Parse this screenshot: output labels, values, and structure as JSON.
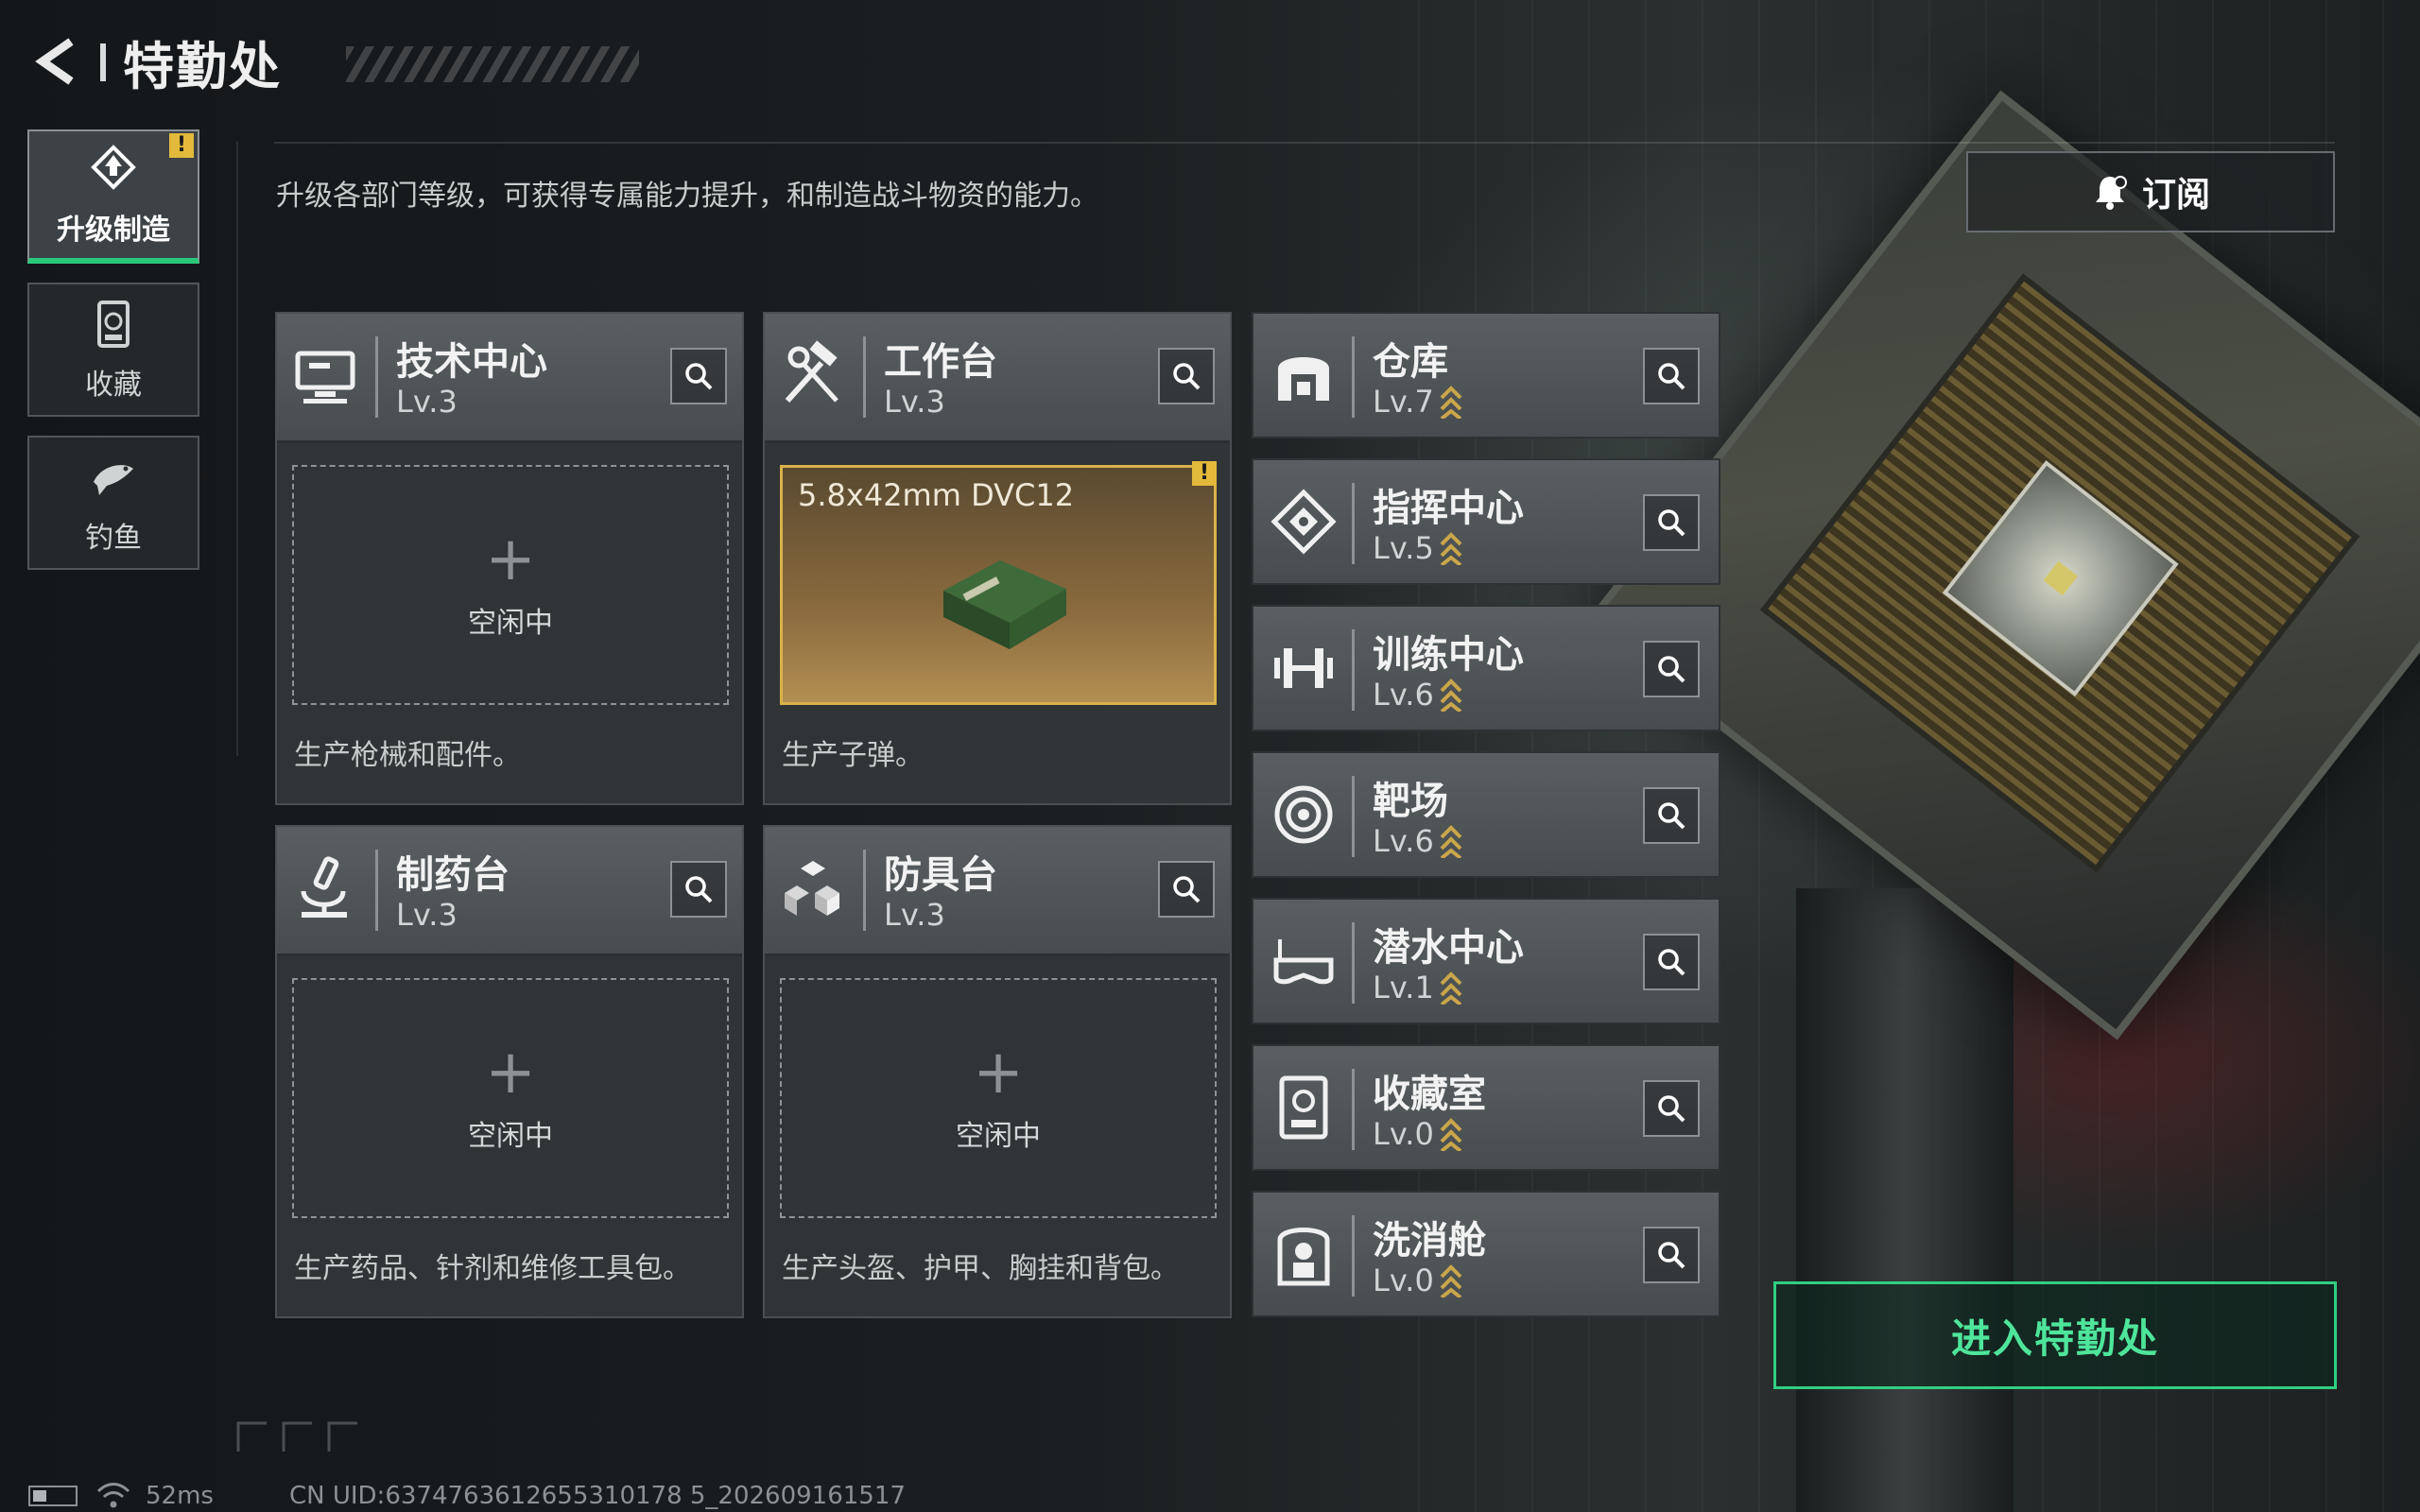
{
  "header": {
    "back_icon": "back-arrow-icon",
    "title": "特勤处"
  },
  "nav": {
    "tabs": [
      {
        "label": "升级制造",
        "icon": "upgrade-icon",
        "active": true,
        "alert": "!"
      },
      {
        "label": "收藏",
        "icon": "collection-icon",
        "active": false
      },
      {
        "label": "钓鱼",
        "icon": "fish-icon",
        "active": false
      }
    ]
  },
  "main": {
    "description": "升级各部门等级，可获得专属能力提升，和制造战斗物资的能力。",
    "subscribe_label": "订阅",
    "workshops": [
      {
        "name": "技术中心",
        "level": "Lv.3",
        "icon": "tech-center-icon",
        "status": "空闲中",
        "desc": "生产枪械和配件。"
      },
      {
        "name": "工作台",
        "level": "Lv.3",
        "icon": "workbench-icon",
        "item": "5.8x42mm DVC12",
        "alert": "!",
        "desc": "生产子弹。"
      },
      {
        "name": "制药台",
        "level": "Lv.3",
        "icon": "pharmacy-icon",
        "status": "空闲中",
        "desc": "生产药品、针剂和维修工具包。"
      },
      {
        "name": "防具台",
        "level": "Lv.3",
        "icon": "armor-bench-icon",
        "status": "空闲中",
        "desc": "生产头盔、护甲、胸挂和背包。"
      }
    ],
    "facilities": [
      {
        "name": "仓库",
        "level": "Lv.7",
        "icon": "warehouse-icon"
      },
      {
        "name": "指挥中心",
        "level": "Lv.5",
        "icon": "command-center-icon"
      },
      {
        "name": "训练中心",
        "level": "Lv.6",
        "icon": "training-center-icon"
      },
      {
        "name": "靶场",
        "level": "Lv.6",
        "icon": "shooting-range-icon"
      },
      {
        "name": "潜水中心",
        "level": "Lv.1",
        "icon": "diving-center-icon"
      },
      {
        "name": "收藏室",
        "level": "Lv.0",
        "icon": "collection-room-icon"
      },
      {
        "name": "洗消舱",
        "level": "Lv.0",
        "icon": "decontamination-icon"
      }
    ],
    "enter_label": "进入特勤处"
  },
  "footer": {
    "ping": "52ms",
    "uid": "CN UID:6374763612655310178 5_202609161517"
  },
  "colors": {
    "accent_green": "#2fcf83",
    "alert_yellow": "#e2b93b",
    "upgrade_gold": "#c9a64a"
  }
}
